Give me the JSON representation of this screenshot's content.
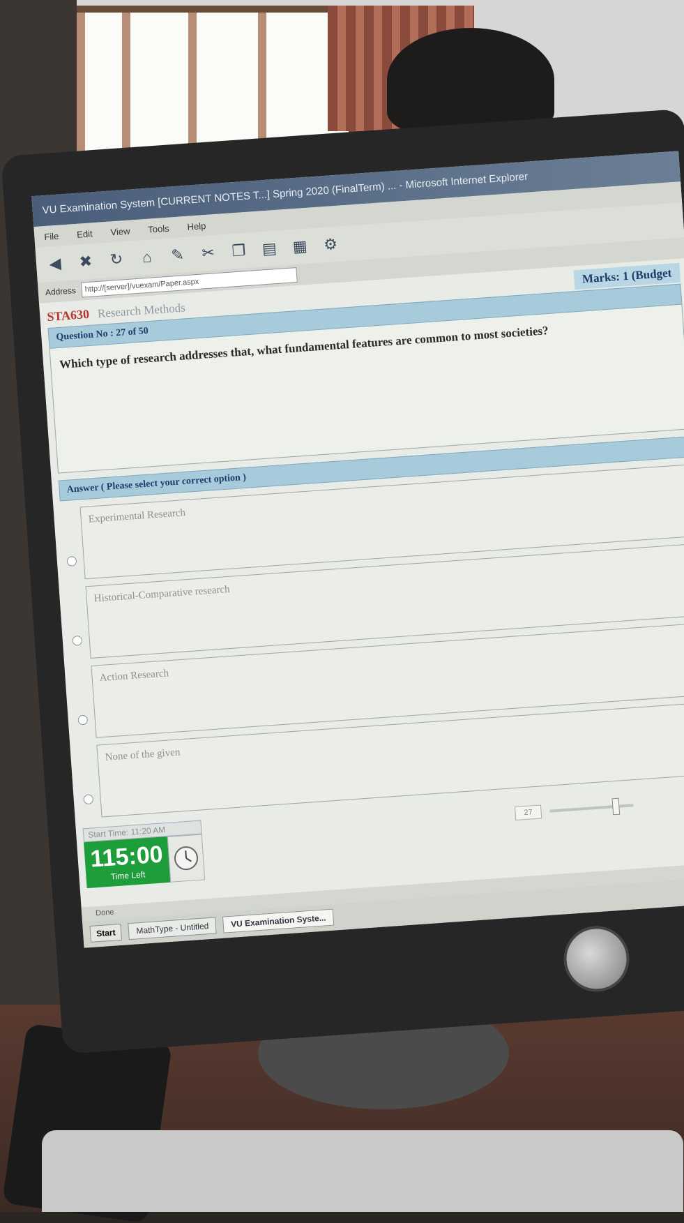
{
  "window": {
    "title": "VU Examination System [CURRENT NOTES T...] Spring 2020 (FinalTerm) ... - Microsoft Internet Explorer",
    "menu": [
      "File",
      "Edit",
      "View",
      "Tools",
      "Help"
    ],
    "address_label": "Address",
    "address_url": "http://[server]/vuexam/Paper.aspx"
  },
  "exam": {
    "course_code": "STA630",
    "course_name": "Research Methods",
    "marks": "Marks: 1 (Budget",
    "question_no": "Question No : 27 of 50",
    "question_text": "Which type of research addresses that, what fundamental features are common to most societies?",
    "answers_header": "Answer ( Please select your correct option )",
    "options": [
      "Experimental Research",
      "Historical-Comparative research",
      "Action Research",
      "None of the given"
    ],
    "start_time": "Start Time: 11:20 AM",
    "time_left_value": "115:00",
    "time_left_label": "Time Left",
    "page_value": "27"
  },
  "status": {
    "done": "Done"
  },
  "taskbar": {
    "start": "Start",
    "item1": "MathType - Untitled",
    "item2": "VU Examination Syste..."
  },
  "colors": {
    "timer_green": "#1e9e3b",
    "course_red": "#b8342d",
    "section_blue": "#a7cbdb"
  }
}
